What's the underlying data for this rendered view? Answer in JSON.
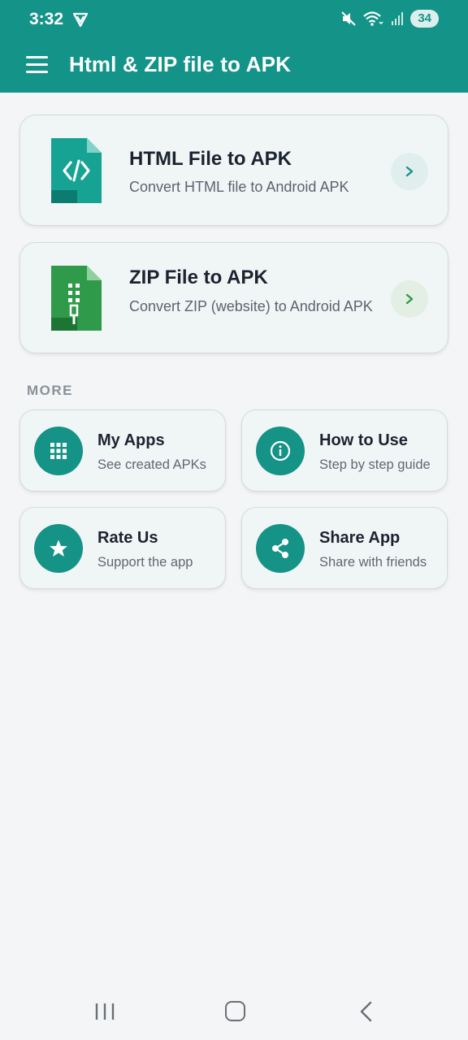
{
  "status_bar": {
    "time": "3:32",
    "battery": "34"
  },
  "app_bar": {
    "title": "Html & ZIP file to APK"
  },
  "cards": [
    {
      "title": "HTML File to APK",
      "subtitle": "Convert HTML file to Android APK",
      "icon": "html-file-icon",
      "color": "#16a394"
    },
    {
      "title": "ZIP File to APK",
      "subtitle": "Convert ZIP (website) to Android APK",
      "icon": "zip-file-icon",
      "color": "#2f9a4a"
    }
  ],
  "section": {
    "more_label": "MORE"
  },
  "quick_actions": [
    {
      "title": "My Apps",
      "subtitle": "See created APKs",
      "icon": "grid-icon"
    },
    {
      "title": "How to Use",
      "subtitle": "Step by step guide",
      "icon": "info-icon"
    },
    {
      "title": "Rate Us",
      "subtitle": "Support the app",
      "icon": "star-icon"
    },
    {
      "title": "Share App",
      "subtitle": "Share with friends",
      "icon": "share-icon"
    }
  ],
  "colors": {
    "primary": "#149488",
    "zip_green": "#2f9a4a",
    "background": "#f3f5f7"
  }
}
